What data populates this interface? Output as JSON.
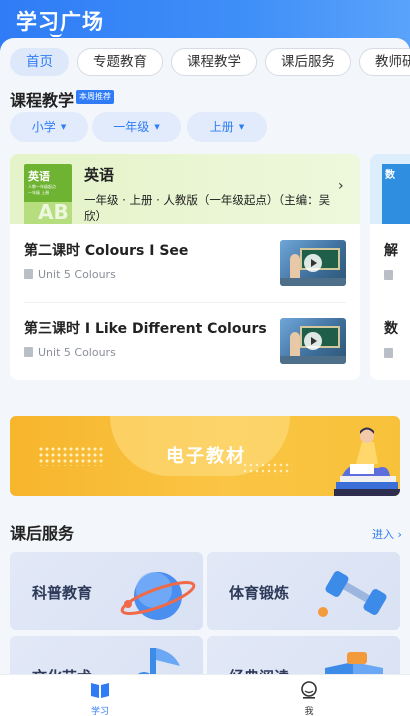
{
  "header": {
    "title": "学习广场"
  },
  "tabs": [
    {
      "label": "首页",
      "active": true
    },
    {
      "label": "专题教育"
    },
    {
      "label": "课程教学"
    },
    {
      "label": "课后服务"
    },
    {
      "label": "教师研"
    }
  ],
  "course_section": {
    "title": "课程教学",
    "badge": "本周推荐",
    "filters": [
      "小学",
      "一年级",
      "上册"
    ]
  },
  "course_card": {
    "cover_title": "英语",
    "cover_subtitle_1": "人教一年级起点",
    "cover_subtitle_2": "一年级 上册",
    "cover_letters": "AB",
    "subject": "英语",
    "description": "一年级 · 上册 · 人教版（一年级起点）（主编：吴欣）",
    "lessons": [
      {
        "title": "第二课时 Colours I See",
        "unit": "Unit 5 Colours"
      },
      {
        "title": "第三课时 I Like Different Colours",
        "unit": "Unit 5 Colours"
      }
    ]
  },
  "peek_card": {
    "cover_title": "数",
    "lesson_1_initial": "解",
    "lesson_2_initial": "数"
  },
  "banner": {
    "label": "电子教材"
  },
  "services": {
    "title": "课后服务",
    "more": "进入",
    "tiles": [
      {
        "label": "科普教育"
      },
      {
        "label": "体育锻炼"
      },
      {
        "label": "文化艺术"
      },
      {
        "label": "经典阅读"
      }
    ]
  },
  "bottom_nav": [
    {
      "label": "学习",
      "active": true
    },
    {
      "label": "我"
    }
  ],
  "colors": {
    "primary": "#2f7cf6",
    "banner": "#f9bd35",
    "english_green": "#6fb332"
  }
}
